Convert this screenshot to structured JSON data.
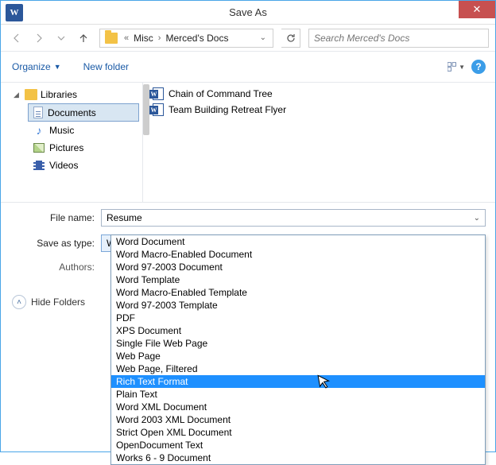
{
  "window": {
    "title": "Save As"
  },
  "nav": {
    "breadcrumb_prefix": "«",
    "segment1": "Misc",
    "segment2": "Merced's Docs"
  },
  "search": {
    "placeholder": "Search Merced's Docs"
  },
  "toolbar": {
    "organize": "Organize",
    "new_folder": "New folder"
  },
  "tree": {
    "root": "Libraries",
    "documents": "Documents",
    "music": "Music",
    "pictures": "Pictures",
    "videos": "Videos"
  },
  "files": {
    "f0": "Chain of Command Tree",
    "f1": "Team Building Retreat Flyer"
  },
  "form": {
    "file_name_label": "File name:",
    "file_name_value": "Resume",
    "save_as_type_label": "Save as type:",
    "save_as_type_value": "Word Document",
    "authors_label": "Authors:"
  },
  "hide_folders_label": "Hide Folders",
  "filetypes": {
    "o0": "Word Document",
    "o1": "Word Macro-Enabled Document",
    "o2": "Word 97-2003 Document",
    "o3": "Word Template",
    "o4": "Word Macro-Enabled Template",
    "o5": "Word 97-2003 Template",
    "o6": "PDF",
    "o7": "XPS Document",
    "o8": "Single File Web Page",
    "o9": "Web Page",
    "o10": "Web Page, Filtered",
    "o11": "Rich Text Format",
    "o12": "Plain Text",
    "o13": "Word XML Document",
    "o14": "Word 2003 XML Document",
    "o15": "Strict Open XML Document",
    "o16": "OpenDocument Text",
    "o17": "Works 6 - 9 Document"
  }
}
